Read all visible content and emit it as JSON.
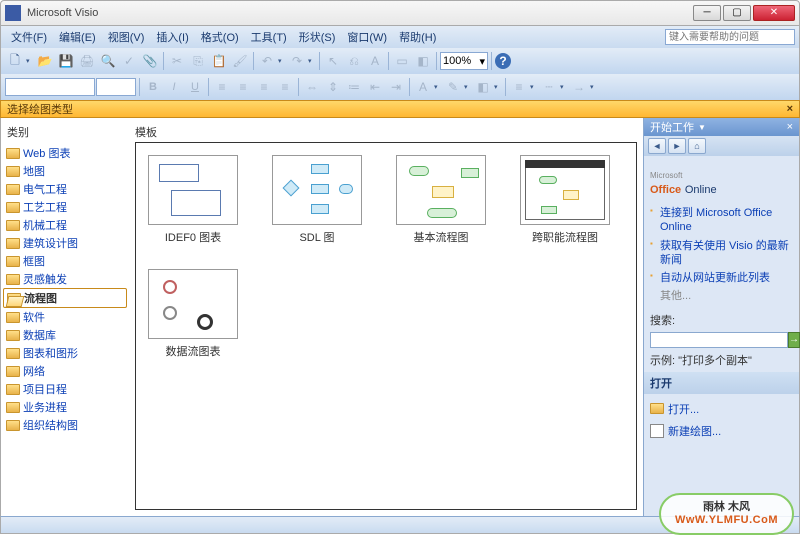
{
  "window": {
    "title": "Microsoft Visio"
  },
  "menu": {
    "file": "文件(F)",
    "edit": "编辑(E)",
    "view": "视图(V)",
    "insert": "插入(I)",
    "format": "格式(O)",
    "tools": "工具(T)",
    "shape": "形状(S)",
    "window": "窗口(W)",
    "help": "帮助(H)",
    "help_placeholder": "键入需要帮助的问题"
  },
  "toolbar": {
    "zoom": "100%"
  },
  "chooser": {
    "title": "选择绘图类型",
    "categories_label": "类别",
    "templates_label": "模板",
    "categories": [
      {
        "label": "Web 图表"
      },
      {
        "label": "地图"
      },
      {
        "label": "电气工程"
      },
      {
        "label": "工艺工程"
      },
      {
        "label": "机械工程"
      },
      {
        "label": "建筑设计图"
      },
      {
        "label": "框图"
      },
      {
        "label": "灵感触发"
      },
      {
        "label": "流程图",
        "selected": true
      },
      {
        "label": "软件"
      },
      {
        "label": "数据库"
      },
      {
        "label": "图表和图形"
      },
      {
        "label": "网络"
      },
      {
        "label": "项目日程"
      },
      {
        "label": "业务进程"
      },
      {
        "label": "组织结构图"
      }
    ],
    "templates": [
      {
        "label": "IDEF0 图表"
      },
      {
        "label": "SDL 图"
      },
      {
        "label": "基本流程图"
      },
      {
        "label": "跨职能流程图"
      },
      {
        "label": "数据流图表"
      }
    ]
  },
  "taskpane": {
    "title": "开始工作",
    "office_prefix": "Microsoft",
    "office_brand": "Office",
    "office_suffix": "Online",
    "links": [
      "连接到 Microsoft Office Online",
      "获取有关使用 Visio 的最新新闻",
      "自动从网站更新此列表"
    ],
    "more": "其他...",
    "search_label": "搜索:",
    "example_label": "示例:",
    "example_text": "\"打印多个副本\"",
    "open_header": "打开",
    "actions": {
      "open": "打开...",
      "new": "新建绘图..."
    }
  },
  "watermark": {
    "name": "雨林 木风",
    "url": "WwW.YLMFU.CoM"
  }
}
